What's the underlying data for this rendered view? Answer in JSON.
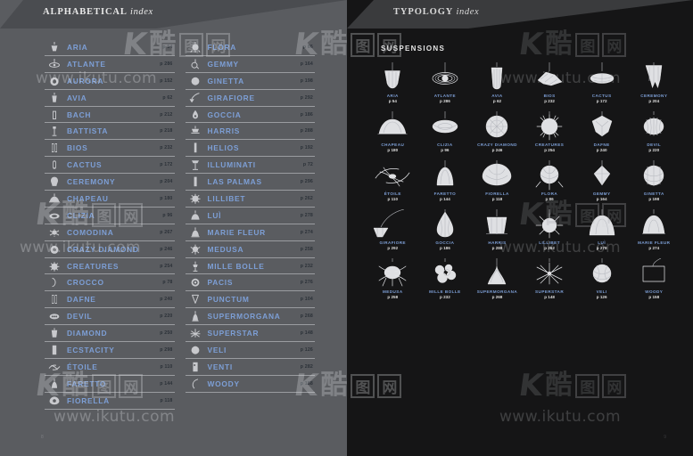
{
  "left_page": {
    "tab": {
      "bold": "ALPHABETICAL",
      "italic": " index"
    },
    "folio": "8",
    "columns": [
      [
        {
          "name": "ARIA",
          "page": "p 54",
          "icon": "lamp-aria"
        },
        {
          "name": "ATLANTE",
          "page": "p 286",
          "icon": "lamp-atlante"
        },
        {
          "name": "AURORA",
          "page": "p 152",
          "icon": "lamp-aurora"
        },
        {
          "name": "AVIA",
          "page": "p 62",
          "icon": "lamp-avia"
        },
        {
          "name": "BACH",
          "page": "p 212",
          "icon": "lamp-bach"
        },
        {
          "name": "BATTISTA",
          "page": "p 218",
          "icon": "lamp-battista"
        },
        {
          "name": "BIOS",
          "page": "p 232",
          "icon": "lamp-bios"
        },
        {
          "name": "CACTUS",
          "page": "p 172",
          "icon": "lamp-cactus"
        },
        {
          "name": "CEREMONY",
          "page": "p 204",
          "icon": "lamp-ceremony"
        },
        {
          "name": "CHAPEAU",
          "page": "p 180",
          "icon": "lamp-chapeau"
        },
        {
          "name": "CLIZIA",
          "page": "p 96",
          "icon": "lamp-clizia"
        },
        {
          "name": "COMODINA",
          "page": "p 267",
          "icon": "lamp-comodina"
        },
        {
          "name": "CRAZY DIAMOND",
          "page": "p 246",
          "icon": "lamp-crazy-diamond"
        },
        {
          "name": "CREATURES",
          "page": "p 254",
          "icon": "lamp-creatures"
        },
        {
          "name": "CROCCO",
          "page": "p 78",
          "icon": "lamp-crocco"
        },
        {
          "name": "DAFNE",
          "page": "p 240",
          "icon": "lamp-dafne"
        },
        {
          "name": "DEVIL",
          "page": "p 220",
          "icon": "lamp-devil"
        },
        {
          "name": "DIAMOND",
          "page": "p 250",
          "icon": "lamp-diamond"
        },
        {
          "name": "ECSTACITY",
          "page": "p 298",
          "icon": "lamp-ecstacity"
        },
        {
          "name": "ÉTOILE",
          "page": "p 110",
          "icon": "lamp-etoile"
        },
        {
          "name": "FARETTO",
          "page": "p 144",
          "icon": "lamp-faretto"
        },
        {
          "name": "FIORELLA",
          "page": "p 118",
          "icon": "lamp-fiorella"
        }
      ],
      [
        {
          "name": "FLORA",
          "page": "p 86",
          "icon": "lamp-flora"
        },
        {
          "name": "GEMMY",
          "page": "p 164",
          "icon": "lamp-gemmy"
        },
        {
          "name": "GINETTA",
          "page": "p 198",
          "icon": "lamp-ginetta"
        },
        {
          "name": "GIRAFIORE",
          "page": "p 292",
          "icon": "lamp-girafiore"
        },
        {
          "name": "GOCCIA",
          "page": "p 186",
          "icon": "lamp-goccia"
        },
        {
          "name": "HARRIS",
          "page": "p 288",
          "icon": "lamp-harris"
        },
        {
          "name": "HELIOS",
          "page": "p 192",
          "icon": "lamp-helios"
        },
        {
          "name": "ILLUMINATI",
          "page": "p 72",
          "icon": "lamp-illuminati"
        },
        {
          "name": "LAS PALMAS",
          "page": "p 296",
          "icon": "lamp-las-palmas"
        },
        {
          "name": "LILLIBET",
          "page": "p 262",
          "icon": "lamp-lillibet"
        },
        {
          "name": "LUÌ",
          "page": "p 278",
          "icon": "lamp-lui"
        },
        {
          "name": "MARIE FLEUR",
          "page": "p 274",
          "icon": "lamp-marie-fleur"
        },
        {
          "name": "MEDUSA",
          "page": "p 258",
          "icon": "lamp-medusa"
        },
        {
          "name": "MILLE BOLLE",
          "page": "p 232",
          "icon": "lamp-mille-bolle"
        },
        {
          "name": "PACIS",
          "page": "p 276",
          "icon": "lamp-pacis"
        },
        {
          "name": "PUNCTUM",
          "page": "p 104",
          "icon": "lamp-punctum"
        },
        {
          "name": "SUPERMORGANA",
          "page": "p 268",
          "icon": "lamp-supermorgana"
        },
        {
          "name": "SUPERSTAR",
          "page": "p 148",
          "icon": "lamp-superstar"
        },
        {
          "name": "VELI",
          "page": "p 126",
          "icon": "lamp-veli"
        },
        {
          "name": "VENTI",
          "page": "p 282",
          "icon": "lamp-venti"
        },
        {
          "name": "WOODY",
          "page": "p 158",
          "icon": "lamp-woody"
        }
      ]
    ]
  },
  "right_page": {
    "tab": {
      "bold": "TYPOLOGY",
      "italic": " index"
    },
    "section_title": "SUSPENSIONS",
    "folio": "9",
    "items": [
      {
        "name": "ARIA",
        "page": "p 54",
        "art": "aria"
      },
      {
        "name": "ATLANTE",
        "page": "p 286",
        "art": "atlante"
      },
      {
        "name": "AVIA",
        "page": "p 62",
        "art": "avia"
      },
      {
        "name": "BIOS",
        "page": "p 232",
        "art": "bios"
      },
      {
        "name": "CACTUS",
        "page": "p 172",
        "art": "cactus"
      },
      {
        "name": "CEREMONY",
        "page": "p 204",
        "art": "ceremony"
      },
      {
        "name": "CHAPEAU",
        "page": "p 180",
        "art": "chapeau"
      },
      {
        "name": "CLIZIA",
        "page": "p 96",
        "art": "clizia"
      },
      {
        "name": "CRAZY DIAMOND",
        "page": "p 246",
        "art": "crazy-diamond"
      },
      {
        "name": "CREATURES",
        "page": "p 254",
        "art": "creatures"
      },
      {
        "name": "DAFNE",
        "page": "p 240",
        "art": "dafne"
      },
      {
        "name": "DEVIL",
        "page": "p 220",
        "art": "devil"
      },
      {
        "name": "ÉTOILE",
        "page": "p 110",
        "art": "etoile"
      },
      {
        "name": "FARETTO",
        "page": "p 144",
        "art": "faretto"
      },
      {
        "name": "FIORELLA",
        "page": "p 118",
        "art": "fiorella"
      },
      {
        "name": "FLORA",
        "page": "p 86",
        "art": "flora"
      },
      {
        "name": "GEMMY",
        "page": "p 164",
        "art": "gemmy"
      },
      {
        "name": "GINETTA",
        "page": "p 198",
        "art": "ginetta"
      },
      {
        "name": "GIRAFIORE",
        "page": "p 292",
        "art": "girafiore"
      },
      {
        "name": "GOCCIA",
        "page": "p 186",
        "art": "goccia"
      },
      {
        "name": "HARRIS",
        "page": "p 288",
        "art": "harris"
      },
      {
        "name": "LILLIBET",
        "page": "p 262",
        "art": "lillibet"
      },
      {
        "name": "LUÌ",
        "page": "p 278",
        "art": "lui"
      },
      {
        "name": "MARIE FLEUR",
        "page": "p 274",
        "art": "marie-fleur"
      },
      {
        "name": "MEDUSA",
        "page": "p 258",
        "art": "medusa"
      },
      {
        "name": "MILLE BOLLE",
        "page": "p 232",
        "art": "mille-bolle"
      },
      {
        "name": "SUPERMORGANA",
        "page": "p 268",
        "art": "supermorgana"
      },
      {
        "name": "SUPERSTAR",
        "page": "p 148",
        "art": "superstar"
      },
      {
        "name": "VELI",
        "page": "p 126",
        "art": "veli"
      },
      {
        "name": "WOODY",
        "page": "p 158",
        "art": "woody"
      }
    ]
  },
  "watermarks": {
    "brand_k": "K",
    "brand_cn": "酷",
    "brand_box1": "图",
    "brand_box2": "网",
    "url": "www.ikutu.com"
  },
  "colors": {
    "left_paper": "#5a5c60",
    "right_paper": "#151516",
    "link_blue": "#7d9fd6",
    "rule": "#9a9ca0"
  }
}
